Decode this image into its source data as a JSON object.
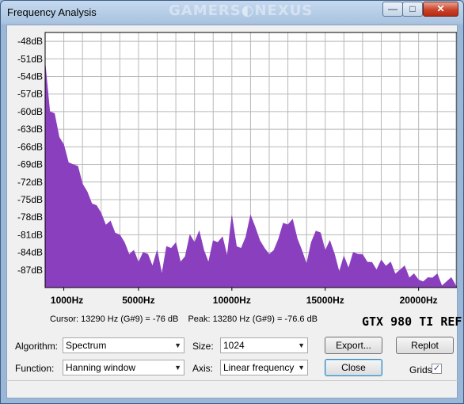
{
  "window": {
    "title": "Frequency Analysis",
    "watermark_left": "GAMERS",
    "watermark_right": "NEXUS",
    "controls": {
      "minimize": "—",
      "maximize": "□",
      "close": "✕"
    }
  },
  "chart_data": {
    "type": "area",
    "color": "#8a3fbe",
    "y_ticks": [
      "-48dB",
      "-51dB",
      "-54dB",
      "-57dB",
      "-60dB",
      "-63dB",
      "-66dB",
      "-69dB",
      "-72dB",
      "-75dB",
      "-78dB",
      "-81dB",
      "-84dB",
      "-87dB"
    ],
    "x_ticks": [
      "1000Hz",
      "5000Hz",
      "10000Hz",
      "15000Hz",
      "20000Hz"
    ],
    "x_tick_values": [
      1000,
      5000,
      10000,
      15000,
      20000
    ],
    "xlim": [
      0,
      22050
    ],
    "ylim": [
      -90,
      -46.5
    ],
    "grid": true,
    "x": [
      0,
      250,
      500,
      750,
      1000,
      1250,
      1500,
      1750,
      2000,
      2250,
      2500,
      2750,
      3000,
      3250,
      3500,
      3750,
      4000,
      4250,
      4500,
      4750,
      5000,
      5250,
      5500,
      5750,
      6000,
      6250,
      6500,
      6750,
      7000,
      7250,
      7500,
      7750,
      8000,
      8250,
      8500,
      8750,
      9000,
      9250,
      9500,
      9750,
      10000,
      10250,
      10500,
      10750,
      11000,
      11250,
      11500,
      11750,
      12000,
      12250,
      12500,
      12750,
      13000,
      13250,
      13500,
      13750,
      14000,
      14250,
      14500,
      14750,
      15000,
      15250,
      15500,
      15750,
      16000,
      16250,
      16500,
      16750,
      17000,
      17250,
      17500,
      17750,
      18000,
      18250,
      18500,
      18750,
      19000,
      19250,
      19500,
      19750,
      20000,
      20250,
      20500,
      20750,
      21000,
      21250,
      21500,
      21750,
      22050
    ],
    "y": [
      -51,
      -60,
      -61,
      -64,
      -66,
      -68,
      -69,
      -70,
      -72,
      -74,
      -75,
      -76,
      -78,
      -79,
      -79,
      -80,
      -81,
      -83,
      -84,
      -84,
      -85,
      -84,
      -85,
      -86,
      -84,
      -87,
      -83,
      -84,
      -82,
      -86,
      -84,
      -81,
      -83,
      -80,
      -84,
      -85,
      -82,
      -83,
      -81,
      -85,
      -77,
      -83,
      -84,
      -81,
      -78,
      -79,
      -82,
      -84,
      -84,
      -84,
      -81,
      -79,
      -80,
      -78,
      -82,
      -83,
      -86,
      -83,
      -80,
      -81,
      -83,
      -82,
      -85,
      -87,
      -85,
      -86,
      -84,
      -85,
      -84,
      -86,
      -85,
      -87,
      -86,
      -86,
      -86,
      -87,
      -87,
      -87,
      -88,
      -88,
      -88,
      -89,
      -89,
      -88,
      -88,
      -89,
      -89,
      -89,
      -90
    ]
  },
  "cursor_info": "Cursor: 13290 Hz (G#9) = -76 dB",
  "peak_info": "Peak: 13280 Hz (G#9) = -76.6 dB",
  "badge": "GTX 980 TI REF",
  "controls": {
    "algorithm_label": "Algorithm:",
    "algorithm_value": "Spectrum",
    "size_label": "Size:",
    "size_value": "1024",
    "function_label": "Function:",
    "function_value": "Hanning window",
    "axis_label": "Axis:",
    "axis_value": "Linear frequency",
    "export_button": "Export...",
    "replot_button": "Replot",
    "close_button": "Close",
    "grids_label": "Grids",
    "grids_checked": true
  }
}
